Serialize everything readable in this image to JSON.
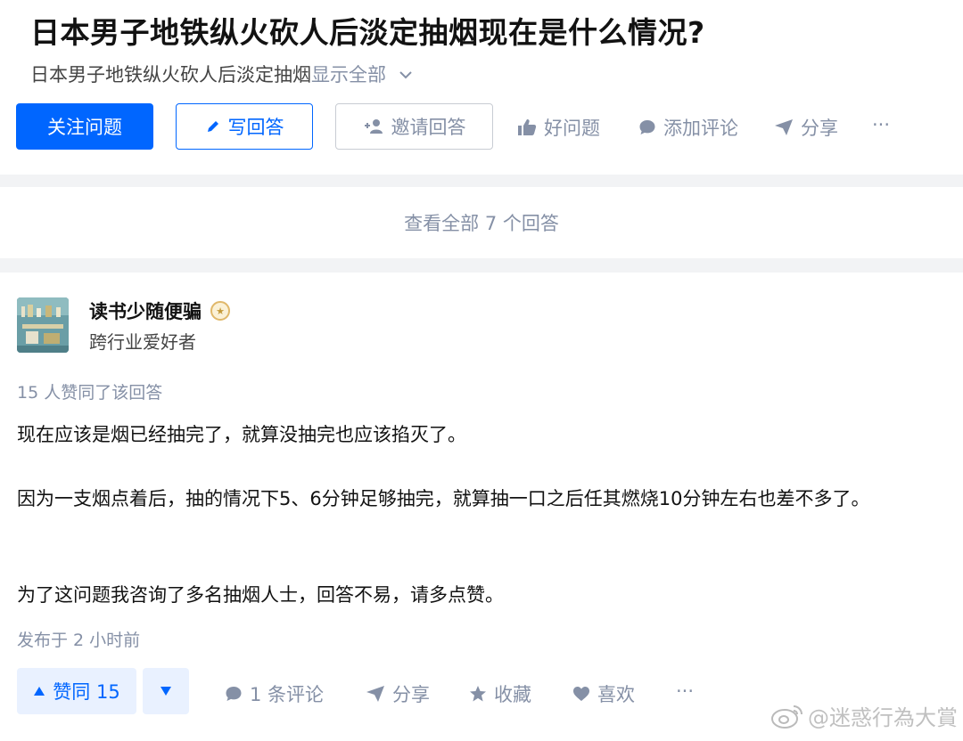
{
  "question": {
    "title": "日本男子地铁纵火砍人后淡定抽烟现在是什么情况?",
    "excerpt": "日本男子地铁纵火砍人后淡定抽烟",
    "show_all": "显示全部"
  },
  "buttons": {
    "follow": "关注问题",
    "write": "写回答",
    "invite": "邀请回答"
  },
  "actions": {
    "good_question": "好问题",
    "add_comment": "添加评论",
    "share": "分享",
    "more": "···"
  },
  "view_all": "查看全部 7 个回答",
  "answer": {
    "author": {
      "name": "读书少随便骗",
      "bio": "跨行业爱好者"
    },
    "votes_text": "15 人赞同了该回答",
    "paragraphs": [
      "现在应该是烟已经抽完了，就算没抽完也应该掐灭了。",
      "因为一支烟点着后，抽的情况下5、6分钟足够抽完，就算抽一口之后任其燃烧10分钟左右也差不多了。",
      "为了这问题我咨询了多名抽烟人士，回答不易，请多点赞。"
    ],
    "time": "发布于 2 小时前",
    "vote_label": "赞同 15",
    "comments": "1 条评论",
    "share": "分享",
    "collect": "收藏",
    "like": "喜欢",
    "more": "···"
  },
  "watermark": "@迷惑行為大賞",
  "colors": {
    "brand": "#0066ff",
    "muted": "#8590a6",
    "text": "#121212"
  },
  "icons": [
    "pencil-icon",
    "add-user-icon",
    "thumb-up-icon",
    "comment-bubble-icon",
    "paper-plane-icon",
    "triangle-up-icon",
    "triangle-down-icon",
    "star-icon",
    "heart-icon",
    "chevron-down-icon",
    "weibo-icon"
  ]
}
